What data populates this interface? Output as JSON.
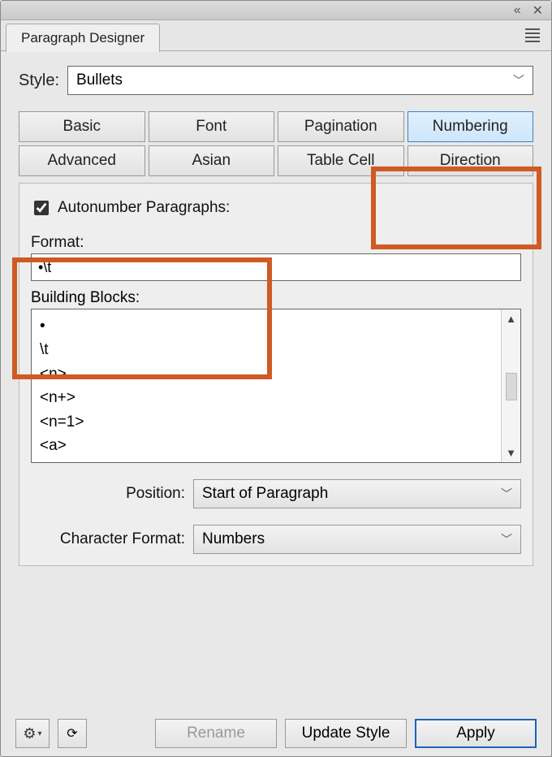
{
  "titlebar": {
    "collapse_glyph": "«",
    "close_glyph": "✕"
  },
  "header": {
    "tab_title": "Paragraph Designer"
  },
  "style": {
    "label": "Style:",
    "value": "Bullets"
  },
  "tabs": {
    "basic": "Basic",
    "font": "Font",
    "pagination": "Pagination",
    "numbering": "Numbering",
    "advanced": "Advanced",
    "asian": "Asian",
    "tablecell": "Table Cell",
    "direction": "Direction"
  },
  "numbering": {
    "autonumber_label": "Autonumber Paragraphs:",
    "format_label": "Format:",
    "format_value": "•\\t",
    "building_blocks_label": "Building Blocks:",
    "blocks": [
      "•",
      "\\t",
      "<n>",
      "<n+>",
      "<n=1>",
      "<a>"
    ],
    "position_label": "Position:",
    "position_value": "Start of Paragraph",
    "charformat_label": "Character Format:",
    "charformat_value": "Numbers"
  },
  "buttons": {
    "rename": "Rename",
    "update_style": "Update Style",
    "apply": "Apply"
  }
}
